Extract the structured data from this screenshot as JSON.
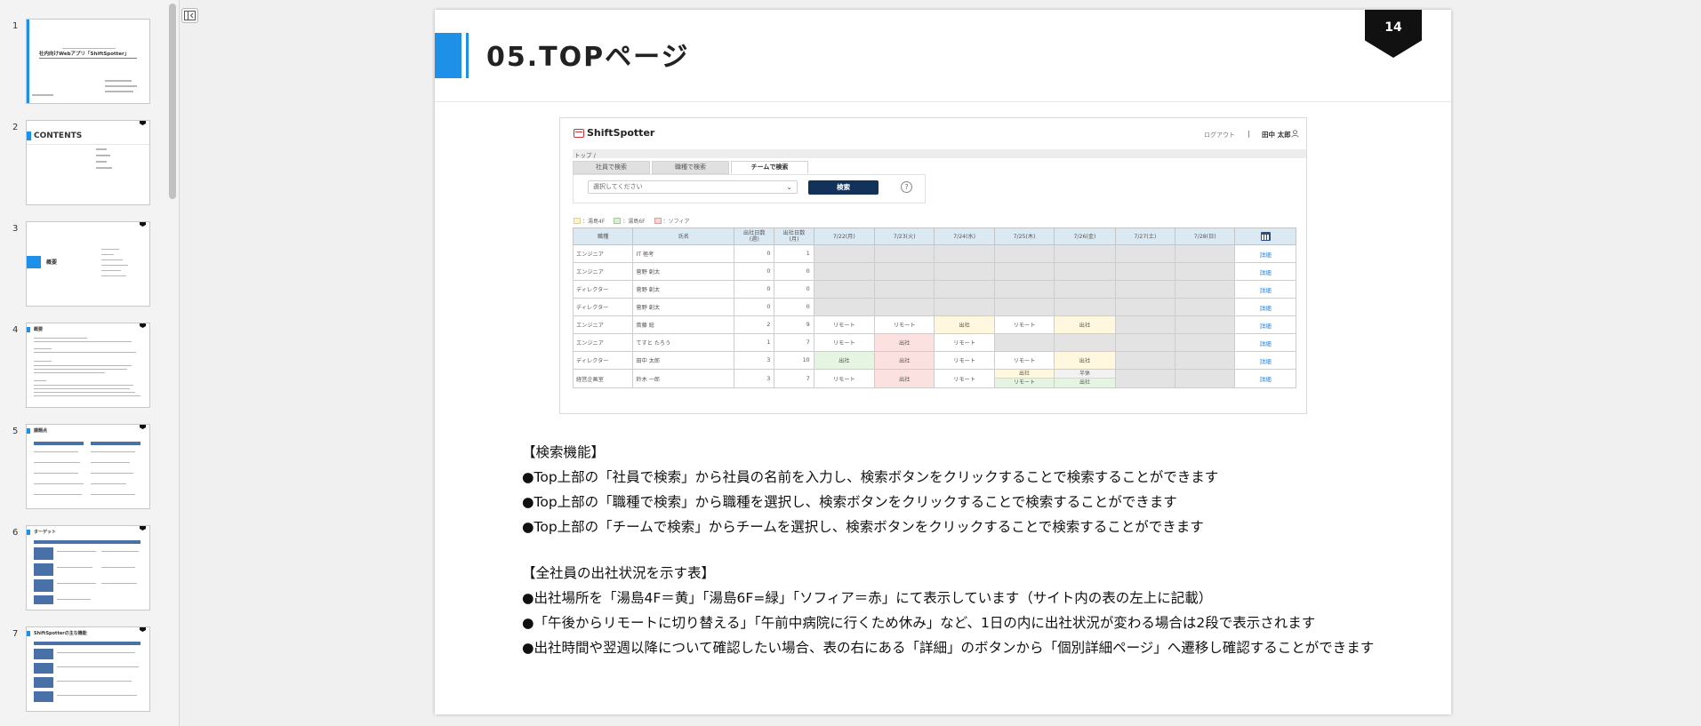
{
  "thumbnails": [
    {
      "number": "1",
      "title": "社内向けWebアプリ「ShiftSpotter」"
    },
    {
      "number": "2",
      "title": "CONTENTS"
    },
    {
      "number": "3",
      "title": "概要"
    },
    {
      "number": "4",
      "title": "概要"
    },
    {
      "number": "5",
      "title": "課題点"
    },
    {
      "number": "6",
      "title": "ターゲット"
    },
    {
      "number": "7",
      "title": "ShiftSpotterの主な機能"
    }
  ],
  "slide": {
    "title": "05.TOPページ",
    "page_number": "14"
  },
  "app": {
    "logo": "ShiftSpotter",
    "logout": "ログアウト",
    "separator": "|",
    "user_name": "田中 太郎",
    "breadcrumb": "トップ /",
    "tabs": [
      "社員で検索",
      "職種で検索",
      "チームで検索"
    ],
    "active_tab": "チームで検索",
    "select_placeholder": "選択してください",
    "search_button": "検索",
    "help": "?",
    "legend": [
      {
        "label": "：湯島4F",
        "color": "#fff3c4"
      },
      {
        "label": "：湯島6F",
        "color": "#d9f0d2"
      },
      {
        "label": "：ソフィア",
        "color": "#f9d4d0"
      }
    ],
    "table": {
      "headers": [
        "職種",
        "氏名",
        "出社日数\n(週)",
        "出社日数\n(月)",
        "7/22(月)",
        "7/23(火)",
        "7/24(水)",
        "7/25(木)",
        "7/26(金)",
        "7/27(土)",
        "7/28(日)"
      ],
      "rows": [
        {
          "role": "エンジニア",
          "name": "IT 極考",
          "week": "0",
          "month": "1",
          "days": [
            "",
            "",
            "",
            "",
            "",
            "",
            ""
          ],
          "detail": "詳細"
        },
        {
          "role": "エンジニア",
          "name": "菅野 創太",
          "week": "0",
          "month": "0",
          "days": [
            "",
            "",
            "",
            "",
            "",
            "",
            ""
          ],
          "detail": "詳細"
        },
        {
          "role": "ディレクター",
          "name": "菅野 創太",
          "week": "0",
          "month": "0",
          "days": [
            "",
            "",
            "",
            "",
            "",
            "",
            ""
          ],
          "detail": "詳細"
        },
        {
          "role": "ディレクター",
          "name": "菅野 創太",
          "week": "0",
          "month": "0",
          "days": [
            "",
            "",
            "",
            "",
            "",
            "",
            ""
          ],
          "detail": "詳細"
        },
        {
          "role": "エンジニア",
          "name": "斎藤 総",
          "week": "2",
          "month": "9",
          "days": [
            "リモート",
            "リモート",
            "出社",
            "リモート",
            "出社",
            "",
            ""
          ],
          "detail": "詳細"
        },
        {
          "role": "エンジニア",
          "name": "てすと たろう",
          "week": "1",
          "month": "7",
          "days": [
            "リモート",
            "出社",
            "リモート",
            "",
            "",
            "",
            ""
          ],
          "detail": "詳細"
        },
        {
          "role": "ディレクター",
          "name": "田中 太郎",
          "week": "3",
          "month": "10",
          "days": [
            "出社",
            "出社",
            "リモート",
            "リモート",
            "出社",
            "",
            ""
          ],
          "detail": "詳細"
        },
        {
          "role": "経営企画室",
          "name": "鈴木 一郎",
          "week": "3",
          "month": "7",
          "days": [
            "リモート",
            "出社",
            "リモート",
            "出社/リモート",
            "半休/出社",
            "",
            ""
          ],
          "detail": "詳細"
        }
      ]
    }
  },
  "description": {
    "search_heading": "【検索機能】",
    "search_items": [
      "●Top上部の「社員で検索」から社員の名前を入力し、検索ボタンをクリックすることで検索することができます",
      "●Top上部の「職種で検索」から職種を選択し、検索ボタンをクリックすることで検索することができます",
      "●Top上部の「チームで検索」からチームを選択し、検索ボタンをクリックすることで検索することができます"
    ],
    "table_heading": "【全社員の出社状況を示す表】",
    "table_items": [
      "●出社場所を「湯島4F＝黄」「湯島6F=緑」「ソフィア＝赤」にて表示しています（サイト内の表の左上に記載）",
      "●「午後からリモートに切り替える」「午前中病院に行くため休み」など、1日の内に出社状況が変わる場合は2段で表示されます",
      "●出社時間や翌週以降について確認したい場合、表の右にある「詳細」のボタンから「個別詳細ページ」へ遷移し確認することができます"
    ]
  },
  "colors": {
    "accent": "#1e90e8",
    "search_button": "#12325a",
    "header_cell": "#dbe9f3",
    "blank_cell": "#e3e3e3",
    "yellow": "#fff8de",
    "green": "#e6f4e2",
    "red": "#fbe1df"
  },
  "icons": [
    "panel-toggle-icon",
    "user-icon",
    "chevron-down-icon",
    "help-icon",
    "calendar-icon"
  ]
}
